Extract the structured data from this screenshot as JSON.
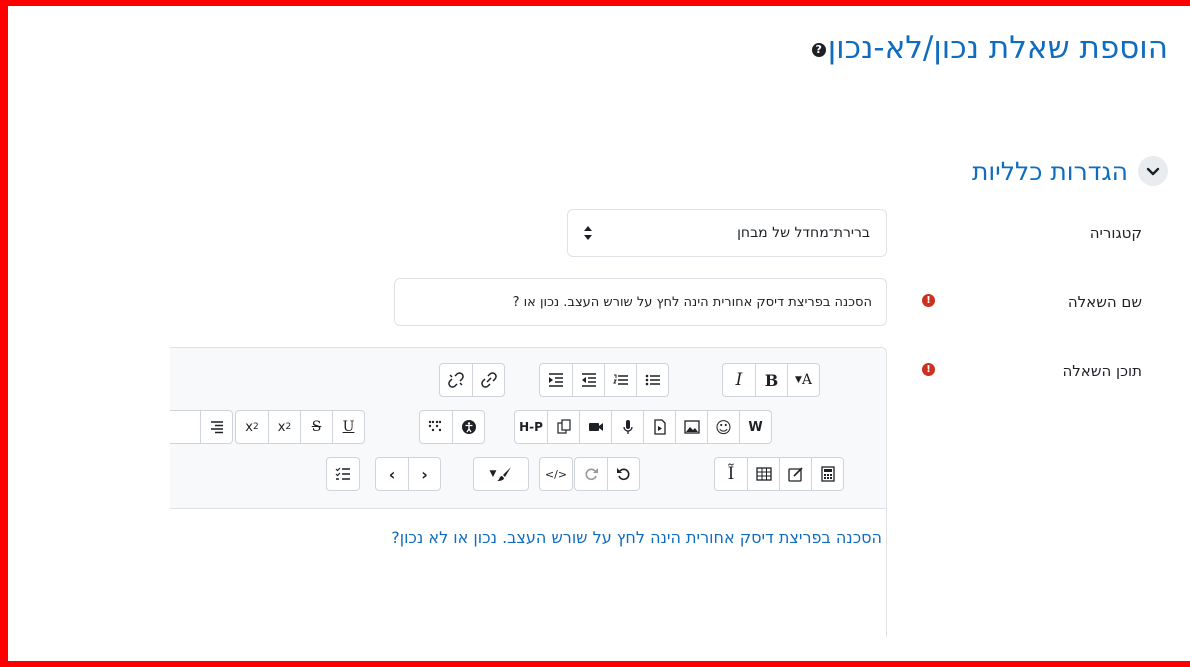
{
  "page": {
    "title": "הוספת שאלת נכון/לא-נכון",
    "help_icon": "question-circle-icon"
  },
  "section": {
    "title": "הגדרות כלליות",
    "toggle_icon": "chevron-down-icon"
  },
  "fields": {
    "category": {
      "label": "קטגוריה",
      "value": "ברירת־מחדל של מבחן"
    },
    "question_name": {
      "label": "שם השאלה",
      "value": "הסכנה בפריצת דיסק אחורית הינה לחץ על שורש העצב.  נכון או ?"
    },
    "question_text": {
      "label": "תוכן השאלה",
      "content": "הסכנה בפריצת דיסק אחורית הינה לחץ על שורש העצב.  נכון או לא נכון?"
    }
  },
  "required_icon": "exclamation-circle-icon",
  "toolbar": {
    "row1": [
      {
        "name": "para-style-button",
        "text": "▾A"
      },
      {
        "name": "bold-button",
        "text": "B"
      },
      {
        "name": "italic-button",
        "text": "I"
      },
      {
        "name": "unordered-list-button",
        "text": ""
      },
      {
        "name": "ordered-list-button",
        "text": ""
      },
      {
        "name": "outdent-button",
        "text": ""
      },
      {
        "name": "indent-button",
        "text": ""
      },
      {
        "name": "link-button",
        "text": ""
      },
      {
        "name": "unlink-button",
        "text": ""
      }
    ],
    "row2": [
      {
        "name": "word-import-button",
        "text": "W"
      },
      {
        "name": "emoji-button",
        "text": "☺"
      },
      {
        "name": "image-button",
        "text": ""
      },
      {
        "name": "media-button",
        "text": ""
      },
      {
        "name": "record-audio-button",
        "text": ""
      },
      {
        "name": "record-video-button",
        "text": ""
      },
      {
        "name": "manage-files-button",
        "text": ""
      },
      {
        "name": "h5p-button",
        "text": "H-P"
      },
      {
        "name": "accessibility-button",
        "text": ""
      },
      {
        "name": "braille-button",
        "text": ""
      },
      {
        "name": "underline-button",
        "text": "U"
      },
      {
        "name": "strikethrough-button",
        "text": "S"
      },
      {
        "name": "subscript-button",
        "text": "x₂"
      },
      {
        "name": "superscript-button",
        "text": "x²"
      },
      {
        "name": "align-button",
        "text": ""
      }
    ],
    "row3": [
      {
        "name": "equation-button",
        "text": ""
      },
      {
        "name": "edit-button",
        "text": ""
      },
      {
        "name": "table-button",
        "text": ""
      },
      {
        "name": "clear-format-button",
        "text": "I"
      },
      {
        "name": "undo-button",
        "text": ""
      },
      {
        "name": "redo-button",
        "text": ""
      },
      {
        "name": "html-button",
        "text": "</>"
      },
      {
        "name": "color-button",
        "text": ""
      },
      {
        "name": "rtl-button",
        "text": ""
      },
      {
        "name": "ltr-button",
        "text": ""
      },
      {
        "name": "checklist-button",
        "text": ""
      }
    ]
  },
  "colors": {
    "accent": "#0f6cbf",
    "error": "#ca3120",
    "border": "#ff0000"
  }
}
